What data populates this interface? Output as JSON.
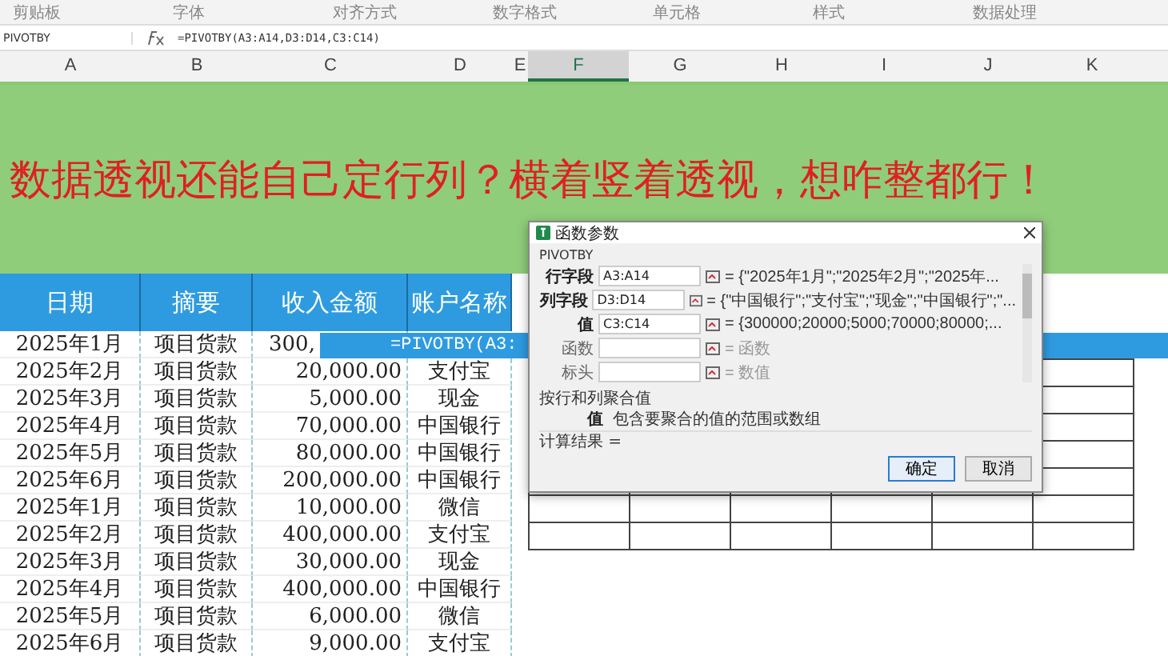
{
  "ribbon": {
    "groups": [
      "剪贴板",
      "字体",
      "对齐方式",
      "数字格式",
      "单元格",
      "样式",
      "数据处理"
    ]
  },
  "formula_bar": {
    "name_box": "PIVOTBY",
    "formula": "=PIVOTBY(A3:A14,D3:D14,C3:C14)"
  },
  "column_headers": [
    {
      "label": "A",
      "selected": false
    },
    {
      "label": "B",
      "selected": false
    },
    {
      "label": "C",
      "selected": false
    },
    {
      "label": "D",
      "selected": false
    },
    {
      "label": "E",
      "selected": false
    },
    {
      "label": "F",
      "selected": true
    },
    {
      "label": "G",
      "selected": false
    },
    {
      "label": "H",
      "selected": false
    },
    {
      "label": "I",
      "selected": false
    },
    {
      "label": "J",
      "selected": false
    },
    {
      "label": "K",
      "selected": false
    }
  ],
  "banner": {
    "title": "数据透视还能自己定行列？横着竖着透视，想咋整都行！"
  },
  "table": {
    "columns": [
      "日期",
      "摘要",
      "收入金额",
      "账户名称"
    ],
    "rows": [
      {
        "date": "2025年1月",
        "summary": "项目货款",
        "amount": "300,"
      },
      {
        "date": "2025年2月",
        "summary": "项目货款",
        "amount": "20,000.00",
        "account": "支付宝"
      },
      {
        "date": "2025年3月",
        "summary": "项目货款",
        "amount": "5,000.00",
        "account": "现金"
      },
      {
        "date": "2025年4月",
        "summary": "项目货款",
        "amount": "70,000.00",
        "account": "中国银行"
      },
      {
        "date": "2025年5月",
        "summary": "项目货款",
        "amount": "80,000.00",
        "account": "中国银行"
      },
      {
        "date": "2025年6月",
        "summary": "项目货款",
        "amount": "200,000.00",
        "account": "中国银行"
      },
      {
        "date": "2025年1月",
        "summary": "项目货款",
        "amount": "10,000.00",
        "account": "微信"
      },
      {
        "date": "2025年2月",
        "summary": "项目货款",
        "amount": "400,000.00",
        "account": "支付宝"
      },
      {
        "date": "2025年3月",
        "summary": "项目货款",
        "amount": "30,000.00",
        "account": "现金"
      },
      {
        "date": "2025年4月",
        "summary": "项目货款",
        "amount": "400,000.00",
        "account": "中国银行"
      },
      {
        "date": "2025年5月",
        "summary": "项目货款",
        "amount": "6,000.00",
        "account": "微信"
      },
      {
        "date": "2025年6月",
        "summary": "项目货款",
        "amount": "9,000.00",
        "account": "支付宝"
      }
    ]
  },
  "cell_editor": {
    "text": "=PIVOTBY(A3:"
  },
  "dialog": {
    "title": "函数参数",
    "function": "PIVOTBY",
    "arguments": [
      {
        "label": "行字段",
        "value": "A3:A14",
        "result": "= {\"2025年1月\";\"2025年2月\";\"2025年...",
        "required": true
      },
      {
        "label": "列字段",
        "value": "D3:D14",
        "result": "= {\"中国银行\";\"支付宝\";\"现金\";\"中国银行\";\"...",
        "required": true
      },
      {
        "label": "值",
        "value": "C3:C14",
        "result": "= {300000;20000;5000;70000;80000;...",
        "required": true
      },
      {
        "label": "函数",
        "result": "= 函数",
        "required": false
      },
      {
        "label": "标头",
        "result": "= 数值",
        "required": false
      }
    ],
    "description": "按行和列聚合值",
    "hint_label": "值",
    "hint": "包含要聚合的值的范围或数组",
    "computed": "计算结果 =",
    "buttons": [
      {
        "label": "确定",
        "kind": "primary"
      },
      {
        "label": "取消",
        "kind": "secondary"
      }
    ]
  }
}
